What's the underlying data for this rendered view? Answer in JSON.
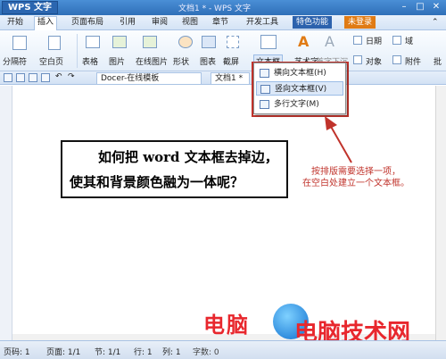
{
  "app": {
    "wps_button": "WPS 文字",
    "title": "文档1 * - WPS 文字"
  },
  "menu": {
    "items": [
      "开始",
      "插入",
      "页面布局",
      "引用",
      "审阅",
      "视图",
      "章节",
      "开发工具"
    ],
    "special": "特色功能",
    "login": "未登录"
  },
  "ribbon": {
    "section_break": "分隔符",
    "blank_page": "空白页",
    "table": "表格",
    "picture": "图片",
    "online_picture": "在线图片",
    "shape": "形状",
    "chart": "图表",
    "screenshot": "截屏",
    "textbox": "文本框",
    "wordart": "艺术字",
    "dropcap": "首字下沉",
    "date": "日期",
    "field": "域",
    "object": "对象",
    "attachment": "附件",
    "more": "批"
  },
  "tabs": {
    "docer": "Docer-在线模板",
    "doc1": "文档1 *"
  },
  "dropdown": {
    "horizontal": "横向文本框(H)",
    "vertical": "竖向文本框(V)",
    "multiline": "多行文字(M)"
  },
  "document": {
    "line1": "如何把 word 文本框去掉边，",
    "line2": "使其和背景颜色融为一体呢？"
  },
  "annotation": {
    "line1": "按排版需要选择一项，",
    "line2": "在空白处建立一个文本框。"
  },
  "watermark": {
    "left": "电脑",
    "left2": "技术网",
    "right": "电脑技术网"
  },
  "status": {
    "page": "页码: 1",
    "pages": "页面: 1/1",
    "section": "节: 1/1",
    "line": "行: 1",
    "column": "列: 1",
    "wordcount": "字数: 0"
  },
  "colors": {
    "accent": "#2f6fb8",
    "highlight_red": "#c0332b"
  }
}
